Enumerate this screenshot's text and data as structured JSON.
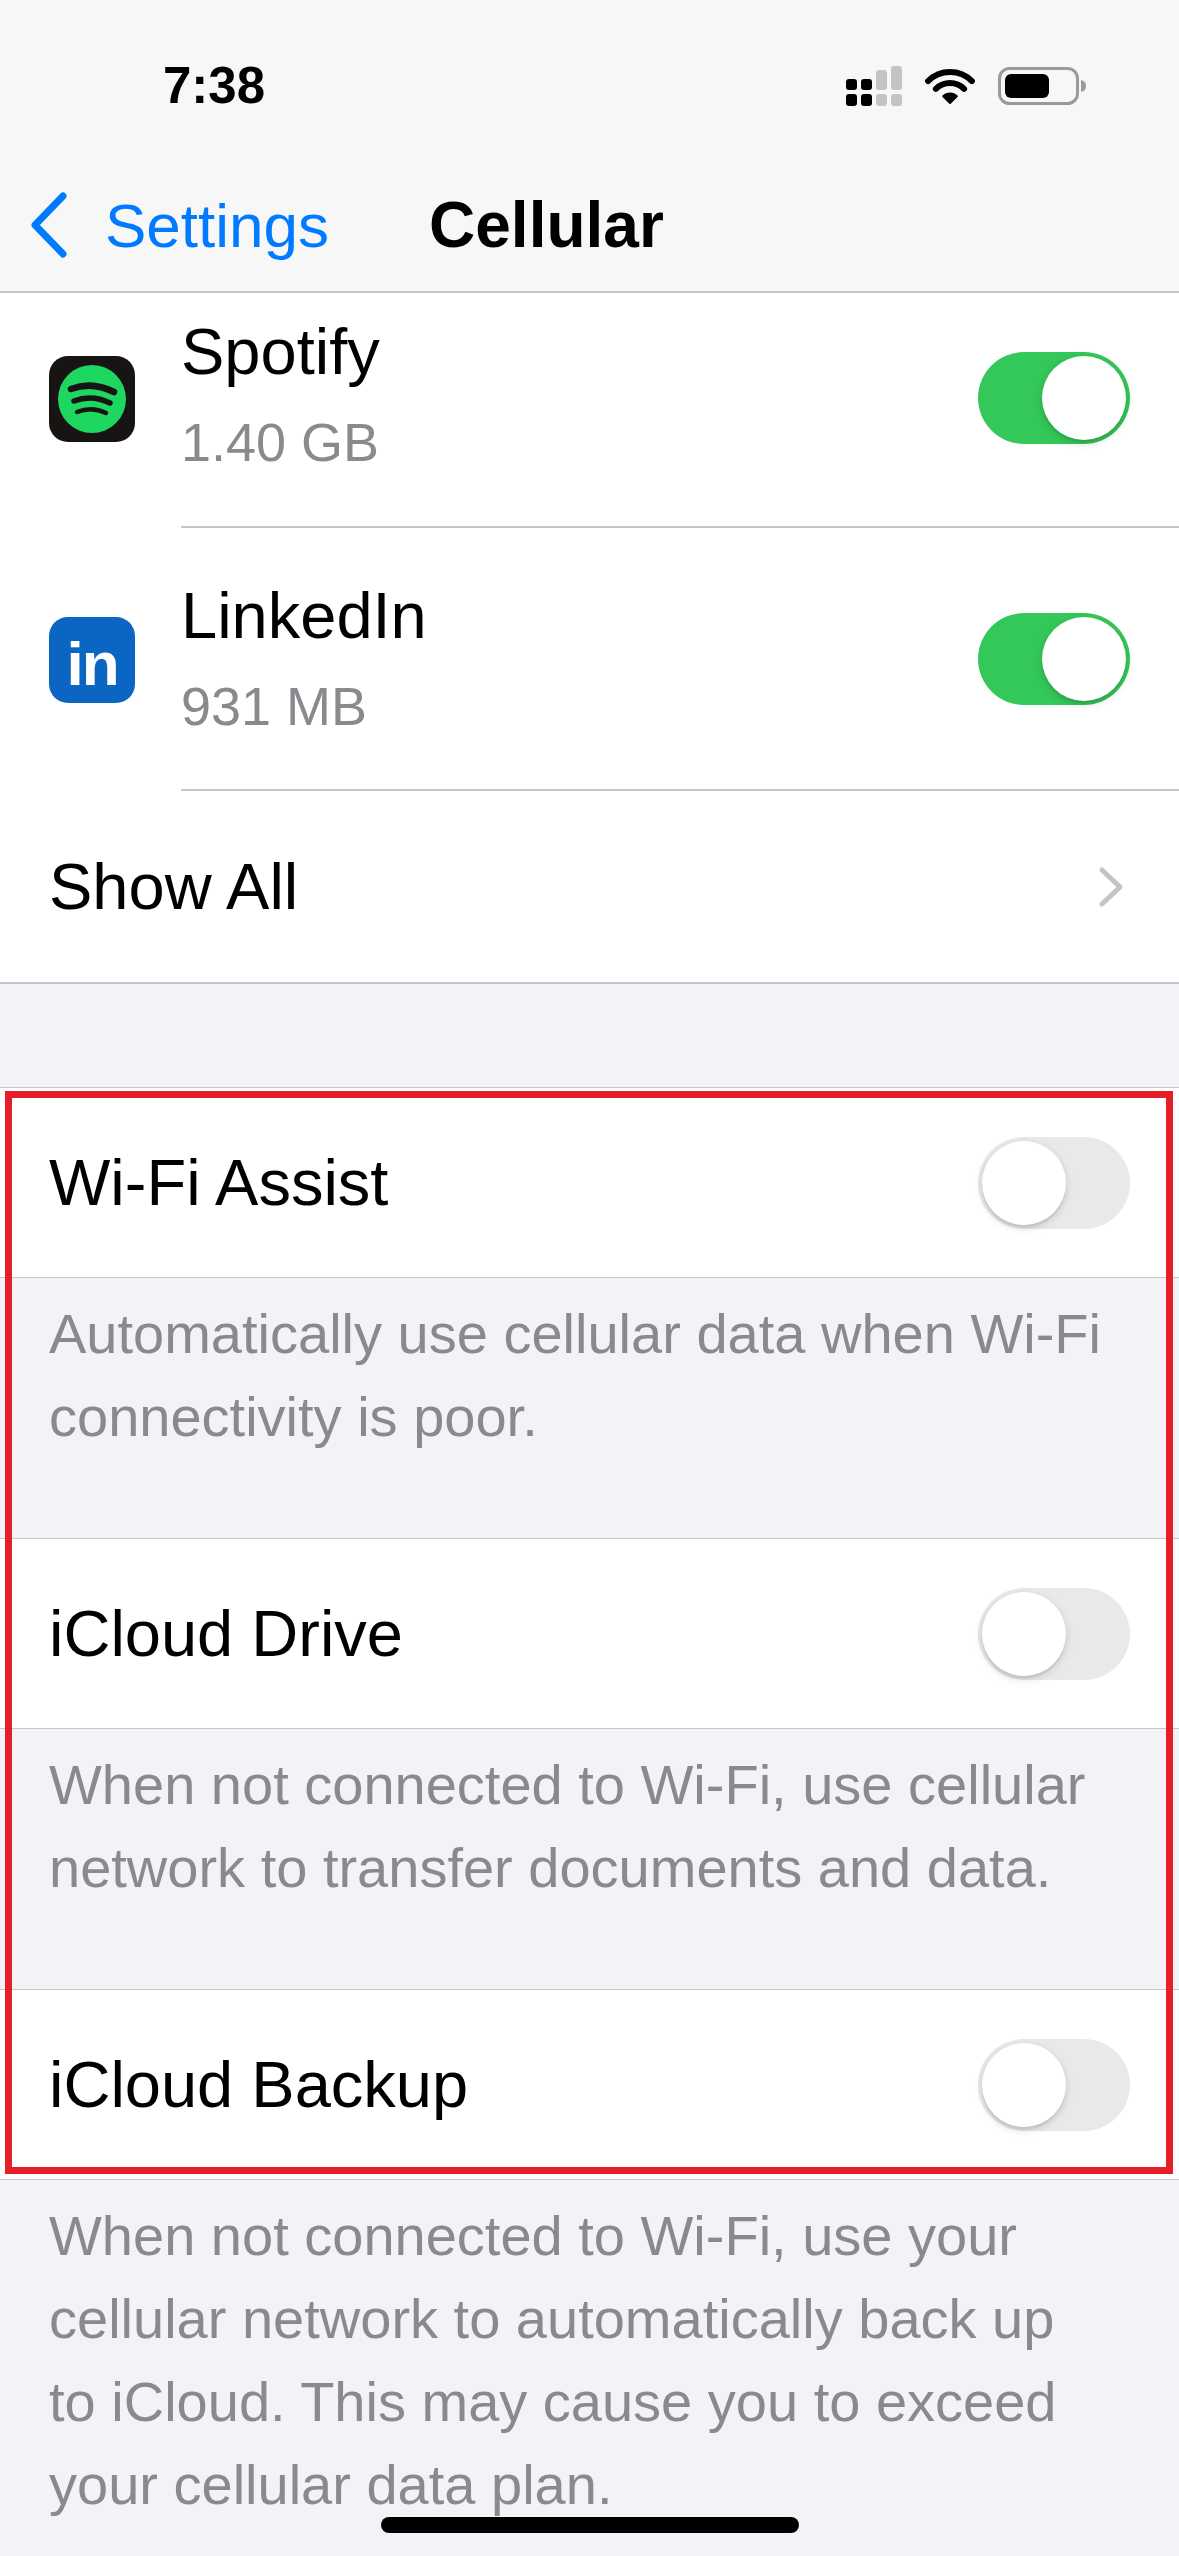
{
  "status_bar": {
    "time": "7:38"
  },
  "nav": {
    "back": "Settings",
    "title": "Cellular"
  },
  "apps": [
    {
      "name": "Spotify",
      "usage": "1.40 GB",
      "on": true,
      "kind": "waves"
    },
    {
      "name": "LinkedIn",
      "usage": "931 MB",
      "on": true,
      "kind": "monogram",
      "monogram": "in"
    }
  ],
  "show_all": "Show All",
  "highlight": true,
  "settings": [
    {
      "label": "Wi-Fi Assist",
      "on": false,
      "footer": "Automatically use cellular data when Wi-Fi connectivity is poor."
    },
    {
      "label": "iCloud Drive",
      "on": false,
      "footer": "When not connected to Wi-Fi, use cellular network to transfer documents and data."
    },
    {
      "label": "iCloud Backup",
      "on": false,
      "footer": "When not connected to Wi-Fi, use your cellular network to automatically back up to iCloud. This may cause you to exceed your cellular data plan."
    }
  ]
}
